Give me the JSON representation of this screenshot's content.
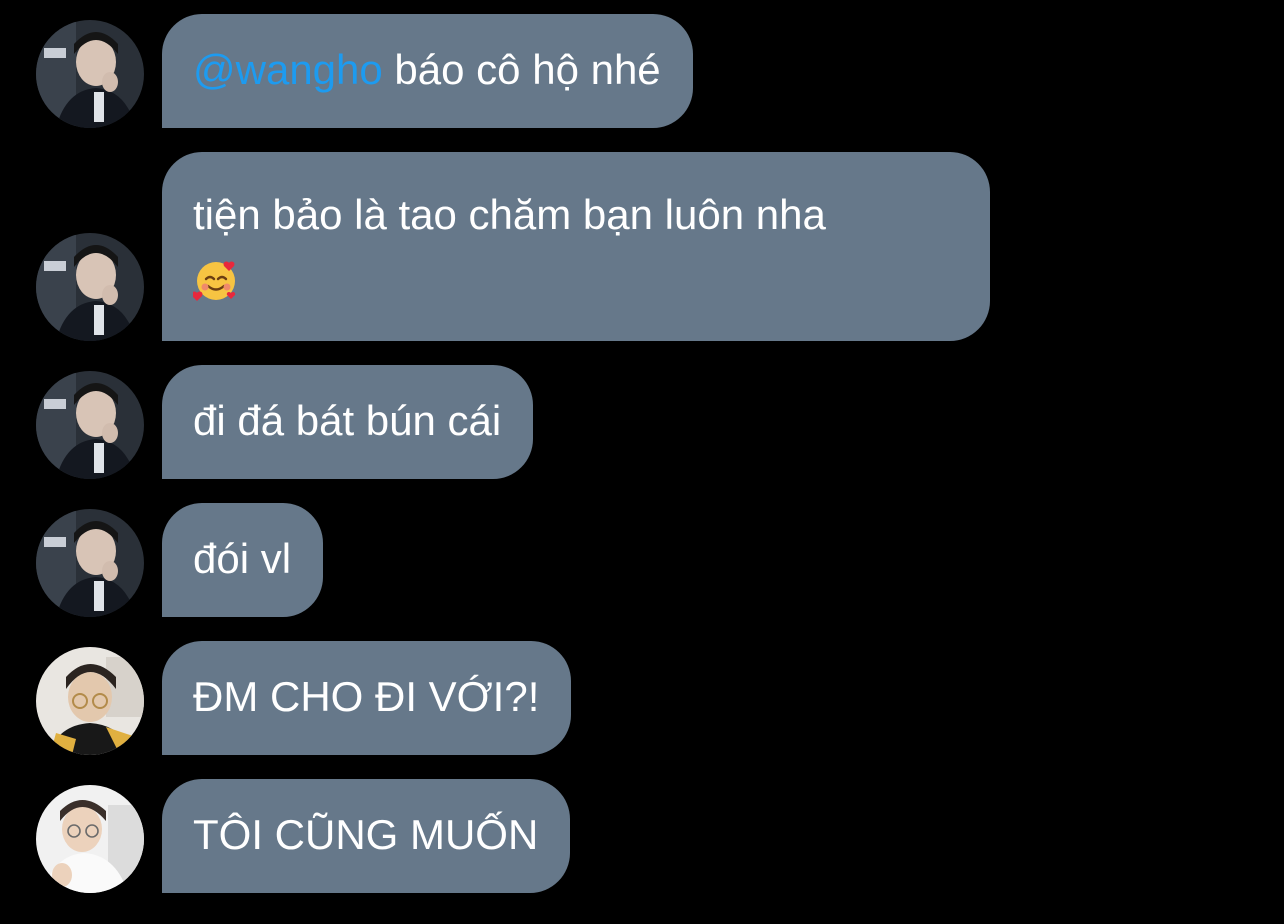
{
  "colors": {
    "background": "#000000",
    "bubble": "#66788a",
    "mention": "#1d9bf0",
    "text": "#ffffff"
  },
  "messages": [
    {
      "avatar": "avatar-a",
      "mention": "@wangho",
      "text": " báo cô hộ nhé"
    },
    {
      "avatar": "avatar-a",
      "text": "tiện bảo là tao chăm bạn luôn nha",
      "emoji": "smiling-face-with-hearts-icon"
    },
    {
      "avatar": "avatar-a",
      "text": "đi đá bát bún cái"
    },
    {
      "avatar": "avatar-a",
      "text": "đói vl"
    },
    {
      "avatar": "avatar-b",
      "text": "ĐM CHO ĐI VỚI?!"
    },
    {
      "avatar": "avatar-c",
      "text": "TÔI CŨNG MUỐN"
    }
  ]
}
